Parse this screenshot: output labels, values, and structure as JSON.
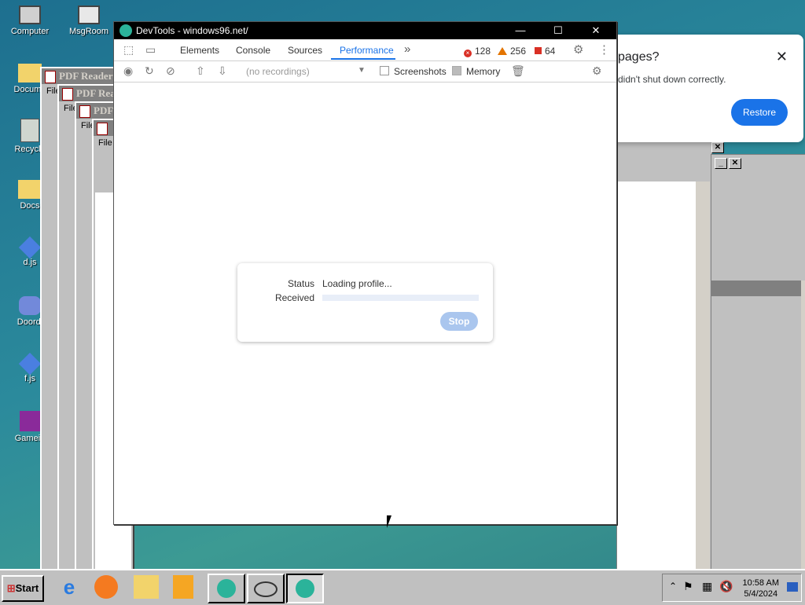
{
  "desktop": {
    "icons": [
      {
        "label": "Computer"
      },
      {
        "label": "MsgRoom"
      },
      {
        "label": "Docume"
      },
      {
        "label": "Recycle"
      },
      {
        "label": "Docs"
      },
      {
        "label": "d.js"
      },
      {
        "label": "Doordi"
      },
      {
        "label": "f.js"
      },
      {
        "label": "Gamein"
      }
    ]
  },
  "pdf_windows": [
    {
      "title": "PDF Reader",
      "menu": "File"
    },
    {
      "title": "PDF Rea",
      "menu": "File"
    },
    {
      "title": "PDF",
      "menu": "File"
    },
    {
      "title": "",
      "menu": "File"
    }
  ],
  "restore_bubble": {
    "title": "pages?",
    "message": "didn't shut down correctly.",
    "button": "Restore",
    "close": "✕"
  },
  "devtools": {
    "window_title": "DevTools - windows96.net/",
    "controls": {
      "minimize": "—",
      "maximize": "☐",
      "close": "✕"
    },
    "tabs": [
      "Elements",
      "Console",
      "Sources",
      "Performance"
    ],
    "more_tabs": "»",
    "counters": {
      "errors": "128",
      "warnings": "256",
      "issues": "64"
    },
    "recordings_placeholder": "(no recordings)",
    "screenshots_label": "Screenshots",
    "memory_label": "Memory",
    "dialog": {
      "status_label": "Status",
      "status_value": "Loading profile...",
      "received_label": "Received",
      "progress": 0.0,
      "stop_button": "Stop"
    }
  },
  "taskbar": {
    "start_label": "Start",
    "time": "10:58 AM",
    "date": "5/4/2024"
  }
}
